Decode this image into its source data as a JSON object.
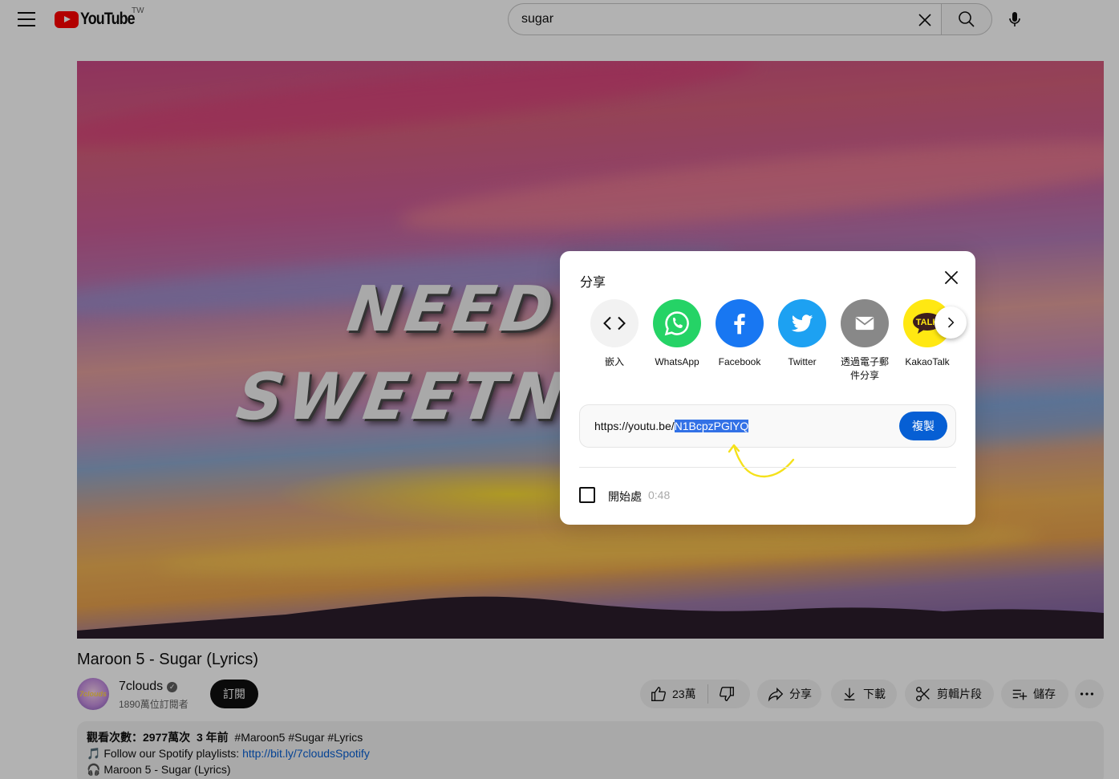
{
  "header": {
    "logo_text": "YouTube",
    "country": "TW",
    "search_value": "sugar"
  },
  "video": {
    "art_line1": "NEED A",
    "art_line2": "SWEETNESS",
    "title": "Maroon 5 - Sugar (Lyrics)"
  },
  "channel": {
    "name": "7clouds",
    "avatar_text": "7clouds",
    "subscribers": "1890萬位訂閱者",
    "subscribe_label": "訂閱"
  },
  "actions": {
    "likes": "23萬",
    "share": "分享",
    "download": "下載",
    "clip": "剪輯片段",
    "save": "儲存"
  },
  "description": {
    "meta_views": "觀看次數：2977萬次",
    "meta_age": "3 年前",
    "meta_tags": "#Maroon5 #Sugar #Lyrics",
    "line2_prefix": "🎵 Follow our Spotify playlists: ",
    "line2_link": "http://bit.ly/7cloudsSpotify",
    "line3": "🎧 Maroon 5 - Sugar (Lyrics)"
  },
  "share_dialog": {
    "title": "分享",
    "targets": [
      {
        "label": "嵌入",
        "icon": "embed-icon",
        "color": "#f2f2f2"
      },
      {
        "label": "WhatsApp",
        "icon": "whatsapp-icon",
        "color": "#25d366"
      },
      {
        "label": "Facebook",
        "icon": "facebook-icon",
        "color": "#1877f2"
      },
      {
        "label": "Twitter",
        "icon": "twitter-icon",
        "color": "#1da1f2"
      },
      {
        "label": "透過電子郵件分享",
        "icon": "email-icon",
        "color": "#888888"
      },
      {
        "label": "KakaoTalk",
        "icon": "kakaotalk-icon",
        "color": "#ffe812"
      }
    ],
    "url_prefix": "https://youtu.be/",
    "url_id": "N1BcpzPGlYQ",
    "copy_label": "複製",
    "start_label": "開始處",
    "start_time": "0:48"
  }
}
